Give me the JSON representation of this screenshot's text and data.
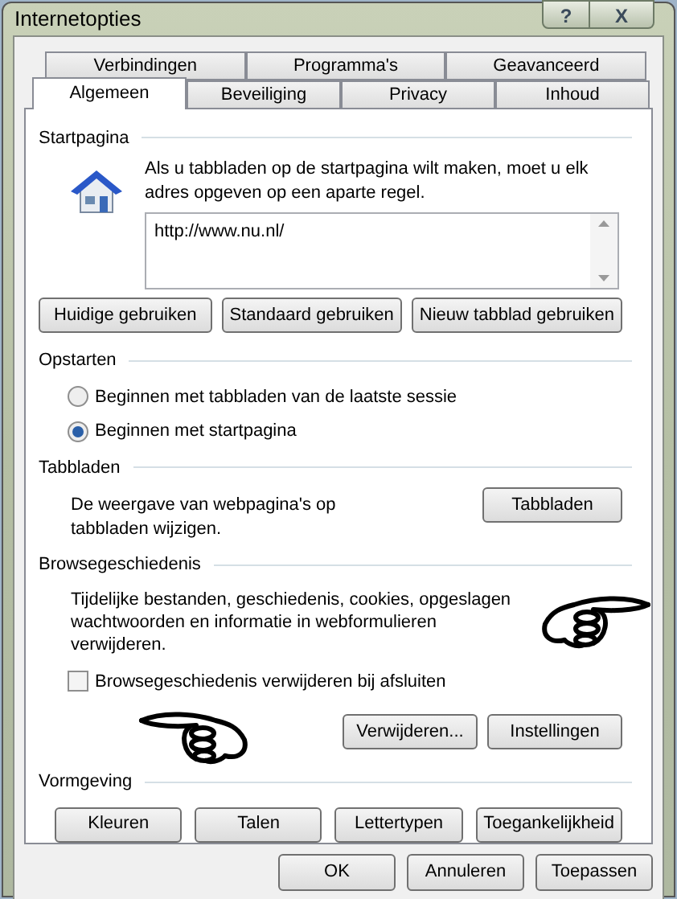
{
  "window": {
    "title": "Internetopties",
    "help_glyph": "?",
    "close_glyph": "X"
  },
  "tab_rows": [
    [
      {
        "label": "Verbindingen",
        "selected": false
      },
      {
        "label": "Programma's",
        "selected": false
      },
      {
        "label": "Geavanceerd",
        "selected": false
      }
    ],
    [
      {
        "label": "Algemeen",
        "selected": true
      },
      {
        "label": "Beveiliging",
        "selected": false
      },
      {
        "label": "Privacy",
        "selected": false
      },
      {
        "label": "Inhoud",
        "selected": false
      }
    ]
  ],
  "startpagina": {
    "title": "Startpagina",
    "description": "Als u tabbladen op de startpagina wilt maken, moet u elk adres opgeven op een aparte regel.",
    "value": "http://www.nu.nl/",
    "buttons": [
      "Huidige gebruiken",
      "Standaard gebruiken",
      "Nieuw tabblad gebruiken"
    ]
  },
  "opstarten": {
    "title": "Opstarten",
    "options": [
      {
        "label": "Beginnen met tabbladen van de laatste sessie",
        "selected": false
      },
      {
        "label": "Beginnen met startpagina",
        "selected": true
      }
    ]
  },
  "tabbladen": {
    "title": "Tabbladen",
    "description": "De weergave van webpagina's op tabbladen wijzigen.",
    "button": "Tabbladen"
  },
  "browsegeschiedenis": {
    "title": "Browsegeschiedenis",
    "description": "Tijdelijke bestanden, geschiedenis, cookies, opgeslagen wachtwoorden en informatie in webformulieren verwijderen.",
    "checkbox": {
      "label": "Browsegeschiedenis verwijderen bij afsluiten",
      "checked": false
    },
    "buttons": [
      "Verwijderen...",
      "Instellingen"
    ]
  },
  "vormgeving": {
    "title": "Vormgeving",
    "buttons": [
      "Kleuren",
      "Talen",
      "Lettertypen",
      "Toegankelijkheid"
    ]
  },
  "footer_buttons": [
    "OK",
    "Annuleren",
    "Toepassen"
  ]
}
